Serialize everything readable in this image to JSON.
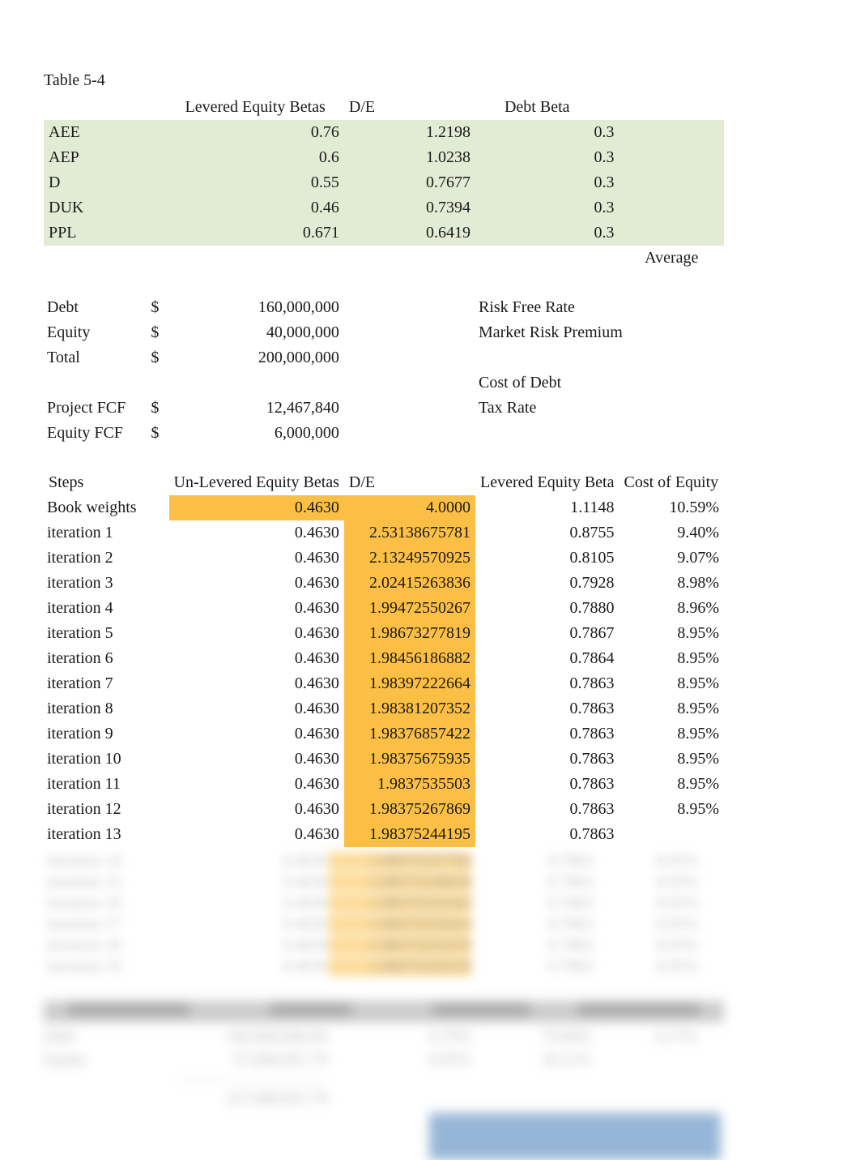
{
  "title": "Table 5-4",
  "betas_table": {
    "headers": {
      "levered": "Levered Equity Betas",
      "de": "D/E",
      "debt": "Debt Beta"
    },
    "rows": [
      {
        "ticker": "AEE",
        "levered": "0.76",
        "de": "1.2198",
        "debt": "0.3"
      },
      {
        "ticker": "AEP",
        "levered": "0.6",
        "de": "1.0238",
        "debt": "0.3"
      },
      {
        "ticker": "D",
        "levered": "0.55",
        "de": "0.7677",
        "debt": "0.3"
      },
      {
        "ticker": "DUK",
        "levered": "0.46",
        "de": "0.7394",
        "debt": "0.3"
      },
      {
        "ticker": "PPL",
        "levered": "0.671",
        "de": "0.6419",
        "debt": "0.3"
      }
    ],
    "average_label": "Average"
  },
  "inputs": {
    "debt": {
      "label": "Debt",
      "value": "160,000,000",
      "side": "Risk Free Rate"
    },
    "equity": {
      "label": "Equity",
      "value": "40,000,000",
      "side": "Market Risk Premium"
    },
    "total": {
      "label": "Total",
      "value": "200,000,000"
    },
    "cost_of_debt": "Cost of Debt",
    "project_fcf": {
      "label": "Project FCF",
      "value": "12,467,840",
      "side": "Tax Rate"
    },
    "equity_fcf": {
      "label": "Equity FCF",
      "value": "6,000,000"
    }
  },
  "currency_symbol": "$",
  "iterations_table": {
    "headers": {
      "steps": "Steps",
      "unlevered": "Un-Levered Equity Betas",
      "de": "D/E",
      "levered": "Levered Equity Beta",
      "coe": "Cost of Equity"
    },
    "rows": [
      {
        "step": "Book weights",
        "ul": "0.4630",
        "de": "4.0000",
        "lev": "1.1148",
        "coe": "10.59%"
      },
      {
        "step": "iteration 1",
        "ul": "0.4630",
        "de": "2.53138675781",
        "lev": "0.8755",
        "coe": "9.40%"
      },
      {
        "step": "iteration 2",
        "ul": "0.4630",
        "de": "2.13249570925",
        "lev": "0.8105",
        "coe": "9.07%"
      },
      {
        "step": "iteration 3",
        "ul": "0.4630",
        "de": "2.02415263836",
        "lev": "0.7928",
        "coe": "8.98%"
      },
      {
        "step": "iteration 4",
        "ul": "0.4630",
        "de": "1.99472550267",
        "lev": "0.7880",
        "coe": "8.96%"
      },
      {
        "step": "iteration 5",
        "ul": "0.4630",
        "de": "1.98673277819",
        "lev": "0.7867",
        "coe": "8.95%"
      },
      {
        "step": "iteration 6",
        "ul": "0.4630",
        "de": "1.98456186882",
        "lev": "0.7864",
        "coe": "8.95%"
      },
      {
        "step": "iteration 7",
        "ul": "0.4630",
        "de": "1.98397222664",
        "lev": "0.7863",
        "coe": "8.95%"
      },
      {
        "step": "iteration 8",
        "ul": "0.4630",
        "de": "1.98381207352",
        "lev": "0.7863",
        "coe": "8.95%"
      },
      {
        "step": "iteration 9",
        "ul": "0.4630",
        "de": "1.98376857422",
        "lev": "0.7863",
        "coe": "8.95%"
      },
      {
        "step": "iteration 10",
        "ul": "0.4630",
        "de": "1.98375675935",
        "lev": "0.7863",
        "coe": "8.95%"
      },
      {
        "step": "iteration 11",
        "ul": "0.4630",
        "de": "1.9837535503",
        "lev": "0.7863",
        "coe": "8.95%"
      },
      {
        "step": "iteration 12",
        "ul": "0.4630",
        "de": "1.98375267869",
        "lev": "0.7863",
        "coe": "8.95%"
      },
      {
        "step": "iteration 13",
        "ul": "0.4630",
        "de": "1.98375244195",
        "lev": "0.7863",
        "coe": ""
      }
    ]
  }
}
